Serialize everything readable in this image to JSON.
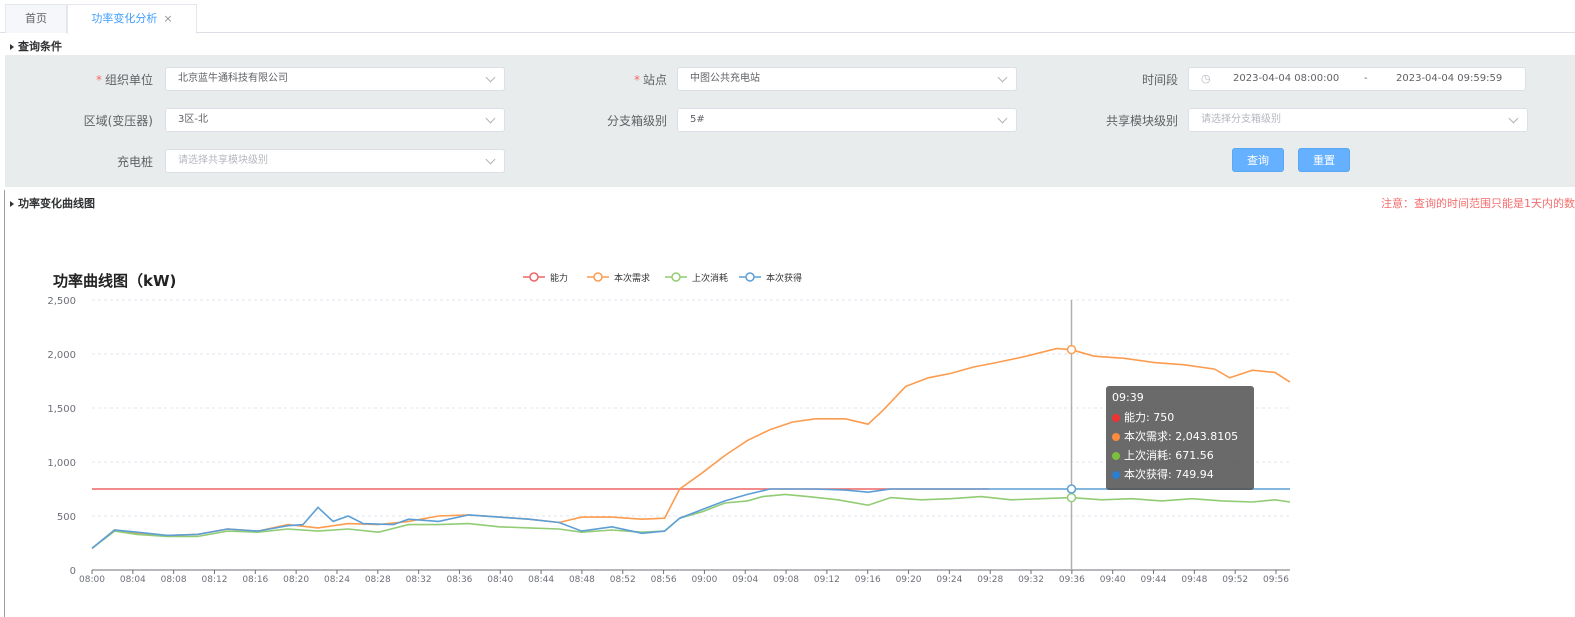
{
  "tabs": {
    "home": "首页",
    "active": "功率变化分析",
    "close": "×"
  },
  "query": {
    "section_title": "查询条件",
    "org_label": "组织单位",
    "org_value": "北京蓝牛通科技有限公司",
    "station_label": "站点",
    "station_value": "中图公共充电站",
    "time_label": "时间段",
    "time_start": "2023-04-04 08:00:00",
    "time_sep": "-",
    "time_end": "2023-04-04 09:59:59",
    "area_label": "区域(变压器)",
    "area_value": "3区-北",
    "branch_label": "分支箱级别",
    "branch_value": "5#",
    "share_label": "共享模块级别",
    "share_placeholder": "请选择分支箱级别",
    "charger_label": "充电桩",
    "charger_placeholder": "请选择共享模块级别",
    "query_button": "查询",
    "reset_button": "重置"
  },
  "curve_section": {
    "title": "功率变化曲线图",
    "notice": "注意：查询的时间范围只能是1天内的数据"
  },
  "chart_data": {
    "type": "line",
    "title": "功率曲线图（kW)",
    "legend_position": "top-center",
    "grid": true,
    "ylim": [
      0,
      2500
    ],
    "yticks": [
      "0",
      "500",
      "1,000",
      "1,500",
      "2,000",
      "2,500"
    ],
    "x_ticks": [
      "08:00",
      "08:04",
      "08:08",
      "08:12",
      "08:16",
      "08:20",
      "08:24",
      "08:28",
      "08:32",
      "08:36",
      "08:40",
      "08:44",
      "08:48",
      "08:52",
      "08:56",
      "09:00",
      "09:04",
      "09:08",
      "09:12",
      "09:16",
      "09:20",
      "09:24",
      "09:28",
      "09:32",
      "09:36",
      "09:40",
      "09:44",
      "09:48",
      "09:52",
      "09:56"
    ],
    "x_range": [
      0,
      119
    ],
    "series": [
      {
        "name": "能力",
        "color": "#ee6666",
        "points": [
          [
            0,
            750
          ],
          [
            119,
            750
          ]
        ]
      },
      {
        "name": "本次需求",
        "color": "#fc9c4f",
        "points": [
          [
            0,
            200
          ],
          [
            3,
            370
          ],
          [
            6,
            340
          ],
          [
            10,
            320
          ],
          [
            14,
            330
          ],
          [
            18,
            380
          ],
          [
            22,
            360
          ],
          [
            26,
            420
          ],
          [
            30,
            390
          ],
          [
            34,
            430
          ],
          [
            38,
            420
          ],
          [
            42,
            450
          ],
          [
            46,
            500
          ],
          [
            50,
            510
          ],
          [
            54,
            490
          ],
          [
            58,
            470
          ],
          [
            62,
            440
          ],
          [
            65,
            490
          ],
          [
            69,
            490
          ],
          [
            73,
            470
          ],
          [
            76,
            480
          ],
          [
            78,
            750
          ],
          [
            81,
            900
          ],
          [
            84,
            1060
          ],
          [
            87,
            1200
          ],
          [
            90,
            1300
          ],
          [
            93,
            1370
          ],
          [
            96,
            1400
          ],
          [
            100,
            1400
          ],
          [
            103,
            1350
          ],
          [
            105,
            1480
          ],
          [
            108,
            1700
          ],
          [
            111,
            1780
          ],
          [
            114,
            1820
          ],
          [
            117,
            1880
          ],
          [
            120,
            1920
          ],
          [
            124,
            1980
          ],
          [
            128,
            2050
          ],
          [
            130,
            2040
          ],
          [
            133,
            1980
          ],
          [
            137,
            1960
          ],
          [
            141,
            1920
          ],
          [
            145,
            1900
          ],
          [
            149,
            1860
          ],
          [
            151,
            1780
          ],
          [
            154,
            1850
          ],
          [
            157,
            1830
          ],
          [
            159,
            1740
          ]
        ]
      },
      {
        "name": "上次消耗",
        "color": "#91cc75",
        "points": [
          [
            0,
            200
          ],
          [
            3,
            360
          ],
          [
            6,
            330
          ],
          [
            10,
            310
          ],
          [
            14,
            310
          ],
          [
            18,
            360
          ],
          [
            22,
            350
          ],
          [
            26,
            380
          ],
          [
            30,
            360
          ],
          [
            34,
            380
          ],
          [
            38,
            350
          ],
          [
            42,
            420
          ],
          [
            46,
            420
          ],
          [
            50,
            430
          ],
          [
            54,
            400
          ],
          [
            58,
            390
          ],
          [
            62,
            380
          ],
          [
            65,
            350
          ],
          [
            69,
            370
          ],
          [
            73,
            350
          ],
          [
            76,
            360
          ],
          [
            78,
            480
          ],
          [
            81,
            540
          ],
          [
            84,
            620
          ],
          [
            87,
            640
          ],
          [
            89,
            680
          ],
          [
            92,
            700
          ],
          [
            95,
            680
          ],
          [
            99,
            650
          ],
          [
            103,
            600
          ],
          [
            106,
            670
          ],
          [
            110,
            650
          ],
          [
            114,
            660
          ],
          [
            118,
            680
          ],
          [
            122,
            650
          ],
          [
            126,
            660
          ],
          [
            130,
            670
          ],
          [
            134,
            650
          ],
          [
            138,
            660
          ],
          [
            142,
            640
          ],
          [
            146,
            660
          ],
          [
            150,
            640
          ],
          [
            154,
            630
          ],
          [
            157,
            650
          ],
          [
            159,
            630
          ]
        ]
      },
      {
        "name": "本次获得",
        "color": "#5c9fd6",
        "points": [
          [
            0,
            200
          ],
          [
            3,
            370
          ],
          [
            6,
            350
          ],
          [
            10,
            320
          ],
          [
            14,
            330
          ],
          [
            18,
            380
          ],
          [
            22,
            360
          ],
          [
            26,
            410
          ],
          [
            28,
            420
          ],
          [
            30,
            580
          ],
          [
            32,
            450
          ],
          [
            34,
            500
          ],
          [
            36,
            430
          ],
          [
            40,
            420
          ],
          [
            42,
            470
          ],
          [
            46,
            450
          ],
          [
            50,
            510
          ],
          [
            54,
            490
          ],
          [
            58,
            470
          ],
          [
            62,
            440
          ],
          [
            65,
            360
          ],
          [
            69,
            400
          ],
          [
            73,
            340
          ],
          [
            76,
            360
          ],
          [
            78,
            480
          ],
          [
            81,
            560
          ],
          [
            84,
            640
          ],
          [
            87,
            700
          ],
          [
            90,
            750
          ],
          [
            93,
            750
          ],
          [
            96,
            750
          ],
          [
            100,
            740
          ],
          [
            103,
            720
          ],
          [
            106,
            750
          ],
          [
            110,
            750
          ],
          [
            130,
            750
          ],
          [
            159,
            750
          ]
        ]
      }
    ],
    "hover": {
      "x": 130,
      "label": "09:39"
    }
  },
  "tooltip": {
    "time": "09:39",
    "rows": [
      {
        "name": "能力",
        "value": "750",
        "color": "#ee3333"
      },
      {
        "name": "本次需求",
        "value": "2,043.8105",
        "color": "#fc8c3f"
      },
      {
        "name": "上次消耗",
        "value": "671.56",
        "color": "#7cbf3a"
      },
      {
        "name": "本次获得",
        "value": "749.94",
        "color": "#2a7fd0"
      }
    ]
  }
}
